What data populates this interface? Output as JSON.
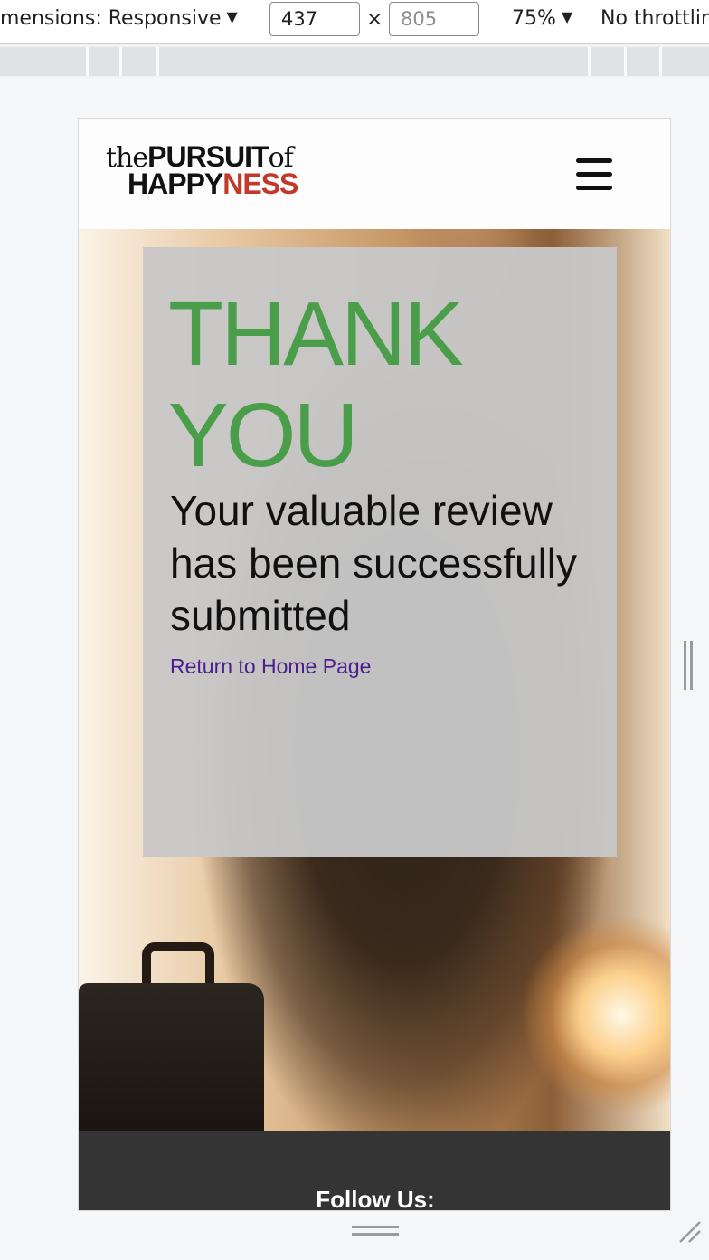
{
  "devtools": {
    "dimensions_label": "mensions: Responsive",
    "width_value": "437",
    "height_placeholder": "805",
    "times_symbol": "×",
    "zoom_label": "75%",
    "throttle_label": "No throttlin"
  },
  "site": {
    "logo": {
      "the": "the",
      "pursuit": "PURSUIT",
      "of": "of",
      "happy": "HAPPY",
      "ness": "NESS"
    },
    "menu_icon": "hamburger-menu-icon"
  },
  "thank_you": {
    "title": "THANK YOU",
    "message": "Your valuable review has been successfully submitted",
    "link_label": "Return to Home Page"
  },
  "footer": {
    "follow_label": "Follow Us:"
  },
  "colors": {
    "title_green": "#4a9e4a",
    "logo_red": "#c0392b",
    "link_purple": "#4a1e8e",
    "footer_bg": "#343434"
  }
}
